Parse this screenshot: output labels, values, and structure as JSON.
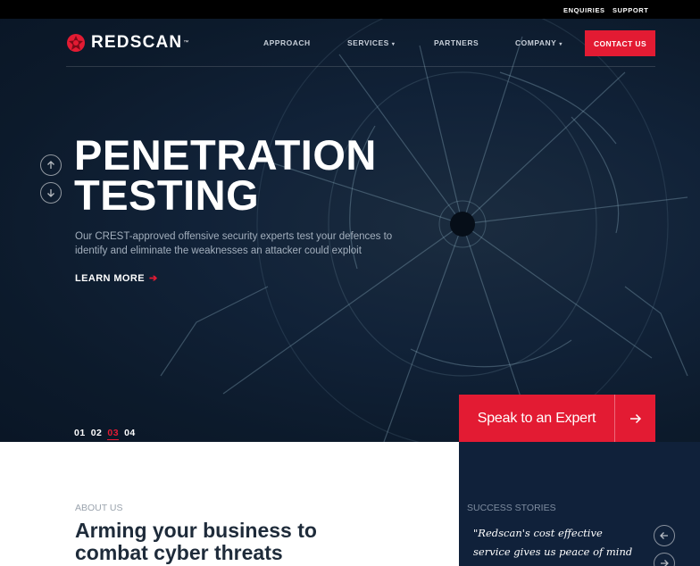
{
  "utility_nav": {
    "enquiries": "ENQUIRIES",
    "support": "SUPPORT"
  },
  "brand": {
    "name": "REDSCAN",
    "trademark": "™",
    "color": "#e31b33"
  },
  "nav": {
    "approach": "APPROACH",
    "services": "SERVICES",
    "partners": "PARTNERS",
    "company": "COMPANY",
    "caret": "▾",
    "contact": "CONTACT US"
  },
  "hero": {
    "title_line1": "PENETRATION",
    "title_line2": "TESTING",
    "description": "Our CREST-approved offensive security experts test your defences to identify and eliminate the weaknesses an attacker could exploit",
    "learn_more": "LEARN MORE",
    "learn_more_arrow": "➔",
    "slides": [
      "01",
      "02",
      "03",
      "04"
    ],
    "active_slide": "03",
    "cta": "Speak to an Expert"
  },
  "about": {
    "eyebrow": "ABOUT US",
    "heading_line1": "Arming your business to",
    "heading_line2": "combat cyber threats"
  },
  "stories": {
    "eyebrow": "SUCCESS STORIES",
    "quote": "\"Redscan's cost effective service gives us peace of mind that we"
  },
  "colors": {
    "hero_bg": "#0c1a2b",
    "accent": "#e31b33",
    "stories_bg": "#10213a"
  }
}
